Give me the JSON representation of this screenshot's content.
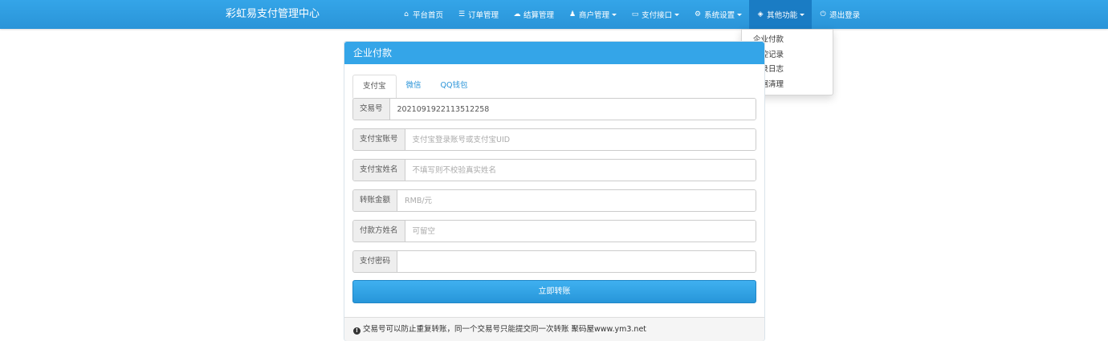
{
  "brand": "彩虹易支付管理中心",
  "nav": [
    {
      "icon": "home-icon",
      "glyph": "⌂",
      "label": "平台首页",
      "dropdown": false,
      "active": false
    },
    {
      "icon": "list-icon",
      "glyph": "☰",
      "label": "订单管理",
      "dropdown": false,
      "active": false
    },
    {
      "icon": "cloud-icon",
      "glyph": "☁",
      "label": "结算管理",
      "dropdown": false,
      "active": false
    },
    {
      "icon": "user-icon",
      "glyph": "♟",
      "label": "商户管理",
      "dropdown": true,
      "active": false
    },
    {
      "icon": "credit-card-icon",
      "glyph": "▭",
      "label": "支付接口",
      "dropdown": true,
      "active": false
    },
    {
      "icon": "gear-icon",
      "glyph": "⚙",
      "label": "系统设置",
      "dropdown": true,
      "active": false
    },
    {
      "icon": "cube-icon",
      "glyph": "◈",
      "label": "其他功能",
      "dropdown": true,
      "active": true
    },
    {
      "icon": "power-icon",
      "glyph": "⏻",
      "label": "退出登录",
      "dropdown": false,
      "active": false
    }
  ],
  "dropdown_items": [
    "企业付款",
    "风控记录",
    "登录日志",
    "数据清理"
  ],
  "panel": {
    "title": "企业付款",
    "tabs": [
      "支付宝",
      "微信",
      "QQ钱包"
    ],
    "active_tab": 0
  },
  "form": {
    "trade_no": {
      "label": "交易号",
      "value": "2021091922113512258",
      "placeholder": ""
    },
    "account": {
      "label": "支付宝账号",
      "value": "",
      "placeholder": "支付宝登录账号或支付宝UID"
    },
    "name": {
      "label": "支付宝姓名",
      "value": "",
      "placeholder": "不填写则不校验真实姓名"
    },
    "amount": {
      "label": "转账金额",
      "value": "",
      "placeholder": "RMB/元"
    },
    "payer": {
      "label": "付款方姓名",
      "value": "",
      "placeholder": "可留空"
    },
    "password": {
      "label": "支付密码",
      "value": "",
      "placeholder": ""
    }
  },
  "submit_label": "立即转账",
  "footer_note": "交易号可以防止重复转账，同一个交易号只能提交同一次转账 聚码屋www.ym3.net",
  "colors": {
    "primary": "#34a5e8",
    "nav_active": "#1a7cc4"
  }
}
